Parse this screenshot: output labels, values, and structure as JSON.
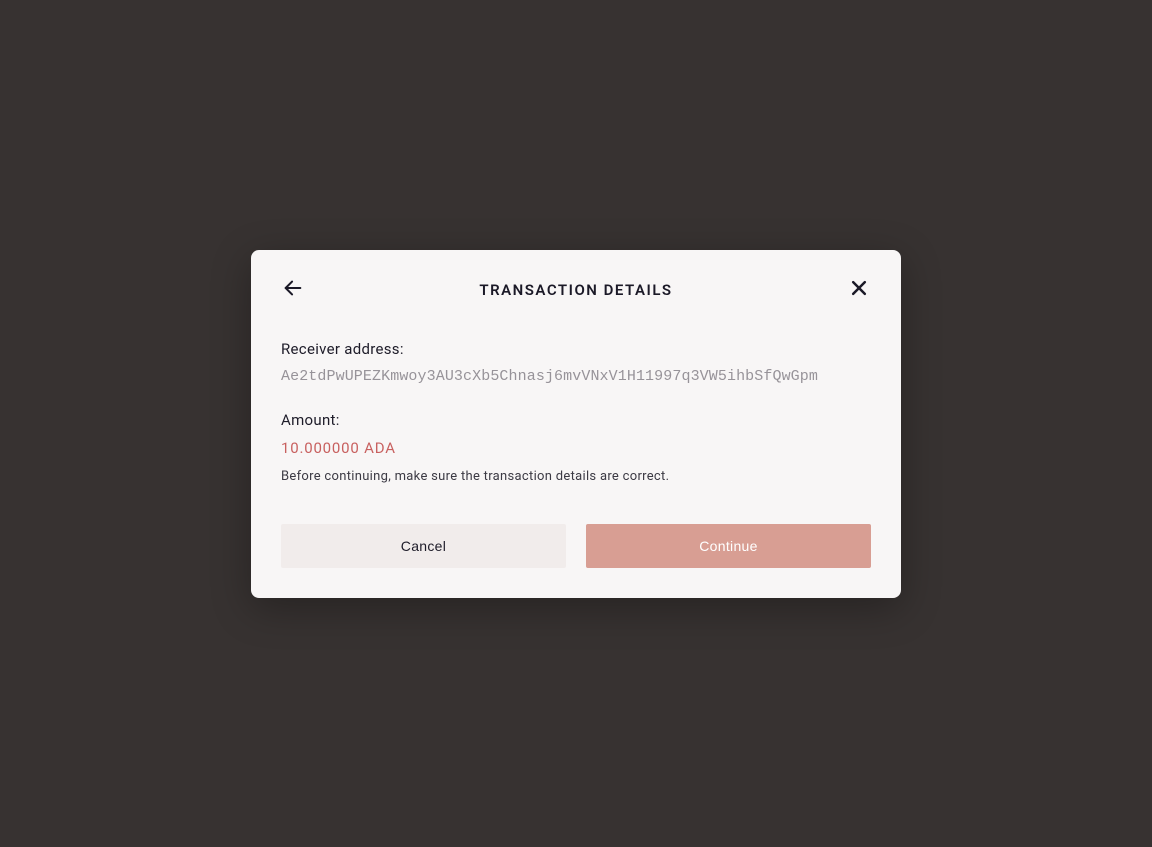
{
  "modal": {
    "title": "TRANSACTION DETAILS",
    "receiver_label": "Receiver address:",
    "receiver_address": "Ae2tdPwUPEZKmwoy3AU3cXb5Chnasj6mvVNxV1H11997q3VW5ihbSfQwGpm",
    "amount_label": "Amount:",
    "amount_value": "10.000000 ADA",
    "warning": "Before continuing, make sure the transaction details are correct.",
    "cancel_label": "Cancel",
    "continue_label": "Continue"
  }
}
